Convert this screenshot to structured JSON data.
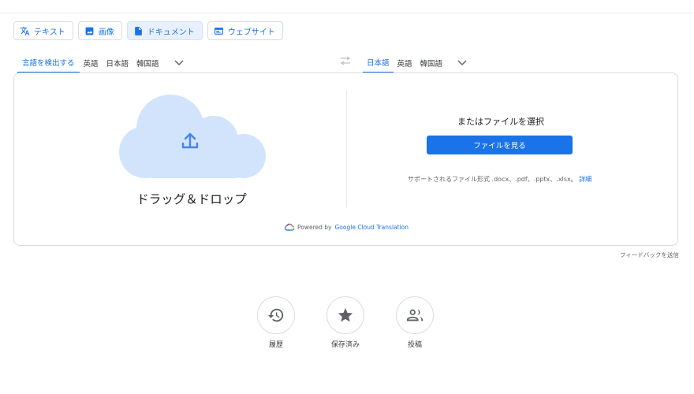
{
  "modes": [
    {
      "label": "テキスト",
      "icon": "translate-icon"
    },
    {
      "label": "画像",
      "icon": "image-icon"
    },
    {
      "label": "ドキュメント",
      "icon": "document-icon"
    },
    {
      "label": "ウェブサイト",
      "icon": "website-icon"
    }
  ],
  "source_langs": [
    "言語を検出する",
    "英語",
    "日本語",
    "韓国語"
  ],
  "target_langs": [
    "日本語",
    "英語",
    "韓国語"
  ],
  "upload": {
    "drop_label": "ドラッグ＆ドロップ",
    "pick_label": "またはファイルを選択",
    "browse_button": "ファイルを見る",
    "support_text": "サポートされるファイル形式 .docx、.pdf、.pptx、.xlsx。",
    "support_link": "詳細",
    "powered_prefix": "Powered by",
    "powered_brand": "Google Cloud Translation"
  },
  "feedback": "フィードバックを送信",
  "quick_actions": [
    {
      "label": "履歴",
      "icon": "history-icon"
    },
    {
      "label": "保存済み",
      "icon": "star-icon"
    },
    {
      "label": "投稿",
      "icon": "community-icon"
    }
  ],
  "colors": {
    "accent": "#1a73e8",
    "cloud": "#d2e3fc",
    "active_tab_bg": "#e8f0fe"
  }
}
